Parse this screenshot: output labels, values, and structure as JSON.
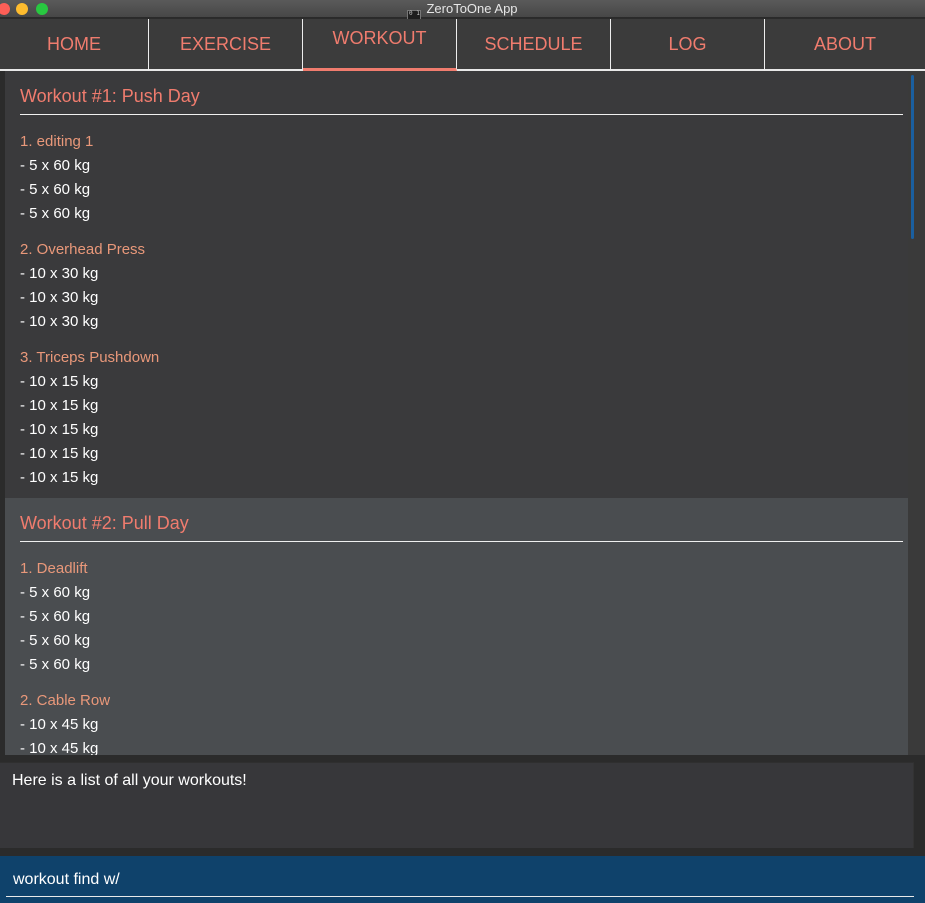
{
  "window": {
    "title": "ZeroToOne App",
    "app_icon_label": "0 1"
  },
  "tabs": [
    {
      "label": "HOME"
    },
    {
      "label": "EXERCISE"
    },
    {
      "label": "WORKOUT"
    },
    {
      "label": "SCHEDULE"
    },
    {
      "label": "LOG"
    },
    {
      "label": "ABOUT"
    }
  ],
  "workouts": [
    {
      "title": "Workout #1:  Push Day",
      "exercises": [
        {
          "name": "1. editing 1",
          "sets": [
            "- 5 x 60 kg",
            "- 5 x 60 kg",
            "- 5 x 60 kg"
          ]
        },
        {
          "name": "2. Overhead Press",
          "sets": [
            "- 10 x 30 kg",
            "- 10 x 30 kg",
            "- 10 x 30 kg"
          ]
        },
        {
          "name": "3. Triceps Pushdown",
          "sets": [
            "- 10 x 15 kg",
            "- 10 x 15 kg",
            "- 10 x 15 kg",
            "- 10 x 15 kg",
            "- 10 x 15 kg"
          ]
        }
      ]
    },
    {
      "title": "Workout #2:  Pull Day",
      "exercises": [
        {
          "name": "1. Deadlift",
          "sets": [
            "- 5 x 60 kg",
            "- 5 x 60 kg",
            "- 5 x 60 kg",
            "- 5 x 60 kg"
          ]
        },
        {
          "name": "2. Cable Row",
          "sets": [
            "- 10 x 45 kg",
            "- 10 x 45 kg"
          ]
        }
      ]
    }
  ],
  "result_display": {
    "text": "Here is a list of all your workouts!"
  },
  "command_box": {
    "value": "workout find w/"
  },
  "colors": {
    "accent": "#f07c6e",
    "exercise_name": "#e9987a",
    "command_bg": "#0f426b",
    "scroll_thumb": "#1a5f9f"
  }
}
